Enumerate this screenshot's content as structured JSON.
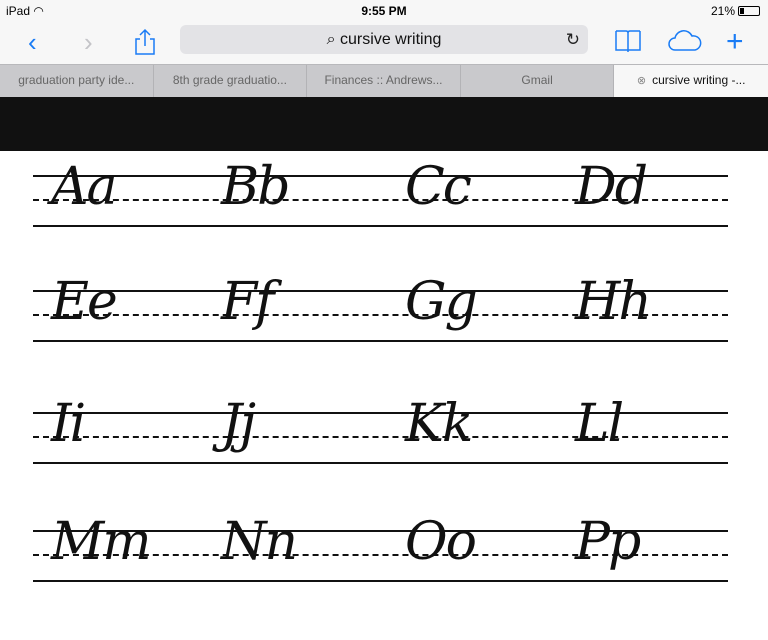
{
  "status": {
    "device": "iPad",
    "time": "9:55 PM",
    "battery": "21%",
    "battery_level": 0.21
  },
  "toolbar": {
    "back_icon": "chevron-left",
    "forward_icon": "chevron-right",
    "share_icon": "share",
    "search_text": "cursive writing",
    "reload_icon": "reload",
    "bookmarks_icon": "book",
    "icloud_icon": "cloud",
    "new_tab_icon": "plus"
  },
  "tabs": [
    {
      "label": "graduation party ide..."
    },
    {
      "label": "8th grade graduatio..."
    },
    {
      "label": "Finances :: Andrews..."
    },
    {
      "label": "Gmail"
    },
    {
      "label": "cursive writing -...",
      "active": true
    }
  ],
  "sheet": {
    "rows": [
      [
        "Aa",
        "Bb",
        "Cc",
        "Dd"
      ],
      [
        "Ee",
        "Ff",
        "Gg",
        "Hh"
      ],
      [
        "Ii",
        "Jj",
        "Kk",
        "Ll"
      ],
      [
        "Mm",
        "Nn",
        "Oo",
        "Pp"
      ]
    ]
  },
  "colors": {
    "accent": "#1a7cf5"
  }
}
